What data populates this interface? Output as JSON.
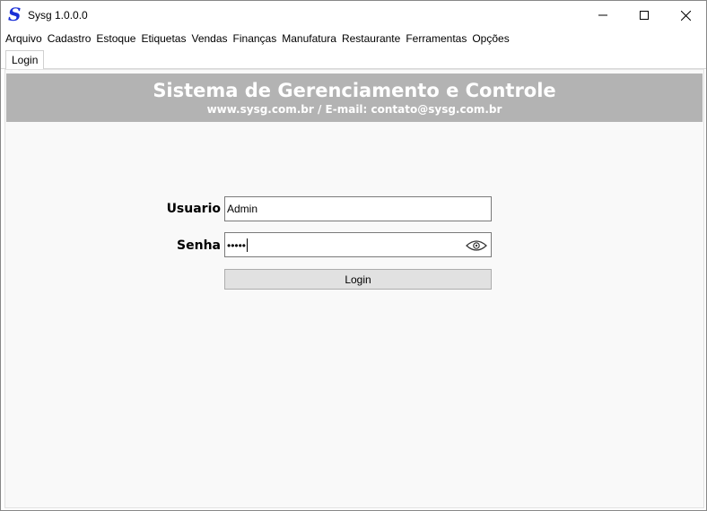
{
  "window": {
    "logo": "S",
    "title": "Sysg 1.0.0.0"
  },
  "menu": [
    {
      "label": "Arquivo"
    },
    {
      "label": "Cadastro"
    },
    {
      "label": "Estoque"
    },
    {
      "label": "Etiquetas"
    },
    {
      "label": "Vendas"
    },
    {
      "label": "Finanças"
    },
    {
      "label": "Manufatura"
    },
    {
      "label": "Restaurante"
    },
    {
      "label": "Ferramentas"
    },
    {
      "label": "Opções"
    }
  ],
  "tabs": [
    {
      "label": "Login"
    }
  ],
  "banner": {
    "title": "Sistema de Gerenciamento e Controle",
    "subtitle": "www.sysg.com.br / E-mail: contato@sysg.com.br"
  },
  "form": {
    "user_label": "Usuario",
    "user_value": "Admin",
    "password_label": "Senha",
    "password_value": "•••••",
    "login_label": "Login"
  },
  "icons": {
    "minimize": "minimize-icon",
    "maximize": "maximize-icon",
    "close": "close-icon",
    "show_password": "eye-icon"
  }
}
